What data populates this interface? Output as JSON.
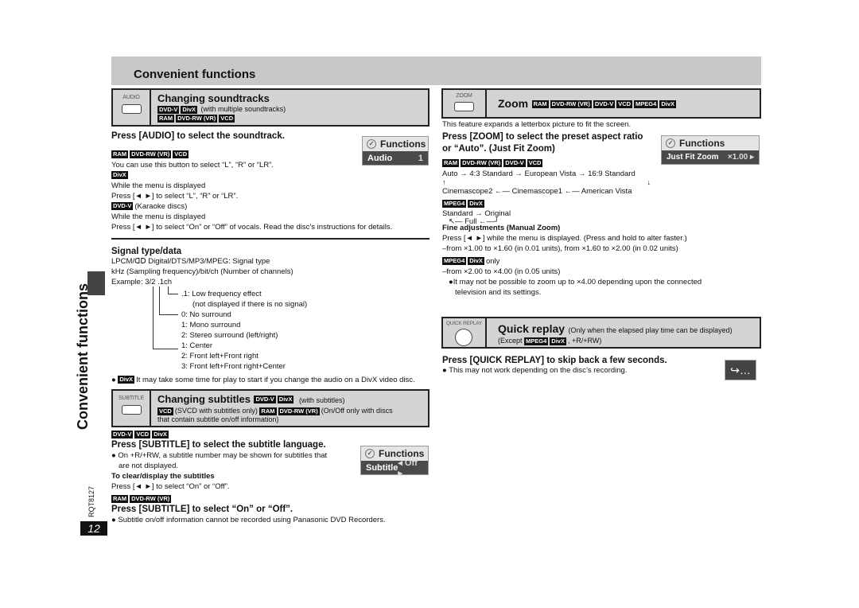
{
  "header": {
    "title": "Convenient functions"
  },
  "side": {
    "title": "Convenient functions",
    "doc_code": "RQT8127",
    "page_number": "12"
  },
  "soundtracks": {
    "button_label": "AUDIO",
    "title": "Changing soundtracks",
    "tags1": [
      "DVD-V",
      "DivX"
    ],
    "note1": "(with multiple soundtracks)",
    "tags2": [
      "RAM",
      "DVD-RW (VR)",
      "VCD"
    ],
    "press": "Press [AUDIO] to select the soundtrack.",
    "osd": {
      "header": "Functions",
      "label": "Audio",
      "value": "1"
    },
    "block1_tags": [
      "RAM",
      "DVD-RW (VR)",
      "VCD"
    ],
    "block1_text": "You can use this button to select “L”, “R” or “LR”.",
    "block2_tag": "DivX",
    "block2_line1": "While the menu is displayed",
    "block2_line2": "Press [◄ ►] to select “L”, “R” or “LR”.",
    "block3_tag": "DVD-V",
    "block3_note": "(Karaoke discs)",
    "block3_line1": "While the menu is displayed",
    "block3_line2": "Press [◄ ►] to select “On” or “Off” of vocals. Read the disc’s instructions for details."
  },
  "signal": {
    "title": "Signal type/data",
    "line1": "LPCM/ᗡᗞ Digital/DTS/MP3/MPEG:  Signal type",
    "line2": "kHz (Sampling frequency)/bit/ch (Number of channels)",
    "example": "Example:  3/2 .1ch",
    "items": [
      ".1:  Low frequency effect",
      "(not displayed if there is no signal)",
      "0:  No surround",
      "1:  Mono surround",
      "2:  Stereo surround (left/right)",
      "1:  Center",
      "2:  Front left+Front right",
      "3:  Front left+Front right+Center"
    ],
    "note_tag": "DivX",
    "note": "It may take some time for play to start if you change the audio on a DivX video disc."
  },
  "subtitles": {
    "button_label": "SUBTITLE",
    "title": "Changing subtitles",
    "tags1": [
      "DVD-V",
      "DivX"
    ],
    "note1": "(with subtitles)",
    "tag_vcd": "VCD",
    "note2": "(SVCD with subtitles only)",
    "tags3": [
      "RAM",
      "DVD-RW (VR)"
    ],
    "note3": "(On/Off only with discs",
    "note4": "that contain subtitle on/off information)",
    "lang_tags": [
      "DVD-V",
      "VCD",
      "DivX"
    ],
    "press_lang": "Press [SUBTITLE] to select the subtitle language.",
    "bullet1": "On +R/+RW, a subtitle number may be shown for subtitles that",
    "bullet1b": "are not displayed.",
    "clear_title": "To clear/display the subtitles",
    "clear_text": "Press [◄ ►] to select “On” or “Off”.",
    "osd": {
      "header": "Functions",
      "label": "Subtitle",
      "value": "◂ Off ▸"
    },
    "onoff_tags": [
      "RAM",
      "DVD-RW (VR)"
    ],
    "press_onoff": "Press [SUBTITLE] to select “On” or “Off”.",
    "bullet2": "Subtitle on/off information cannot be recorded using Panasonic DVD Recorders."
  },
  "zoom": {
    "button_label": "ZOOM",
    "title": "Zoom",
    "tags": [
      "RAM",
      "DVD-RW (VR)",
      "DVD-V",
      "VCD",
      "MPEG4",
      "DivX"
    ],
    "intro": "This feature expands a letterbox picture to fit the screen.",
    "press1": "Press [ZOOM] to select the preset aspect ratio",
    "press2": "or “Auto”. (Just Fit Zoom)",
    "osd": {
      "header": "Functions",
      "label": "Just Fit Zoom",
      "value": "×1.00 ▸"
    },
    "seq_tags": [
      "RAM",
      "DVD-RW (VR)",
      "DVD-V",
      "VCD"
    ],
    "seq1": "Auto → 4:3 Standard → European Vista → 16:9 Standard",
    "seq2": "Cinemascope2 ←— Cinemascope1 ←— American Vista",
    "mpeg_tags": [
      "MPEG4",
      "DivX"
    ],
    "seq3": "Standard → Original",
    "seq4": "Full",
    "fine_title": "Fine adjustments (Manual Zoom)",
    "fine1": "Press [◄ ►] while the menu is displayed. (Press and hold to alter faster.)",
    "fine2": "–from ×1.00 to ×1.60 (in 0.01 units), from ×1.60 to ×2.00 (in 0.02 units)",
    "only_tags": [
      "MPEG4",
      "DivX"
    ],
    "only": "only",
    "fine3": "–from ×2.00 to ×4.00 (in 0.05 units)",
    "fine4": "It may not be possible to zoom up to ×4.00 depending upon the connected",
    "fine5": "television and its settings."
  },
  "quick_replay": {
    "button_label": "QUICK REPLAY",
    "title": "Quick replay",
    "note1": "(Only when the elapsed play time can be displayed)",
    "except": "(Except",
    "tags": [
      "MPEG4",
      "DivX"
    ],
    "note2": ", +R/+RW)",
    "press": "Press [QUICK REPLAY] to skip back a few seconds.",
    "bullet": "This may not work depending on the disc’s recording.",
    "icon": "↪…"
  }
}
